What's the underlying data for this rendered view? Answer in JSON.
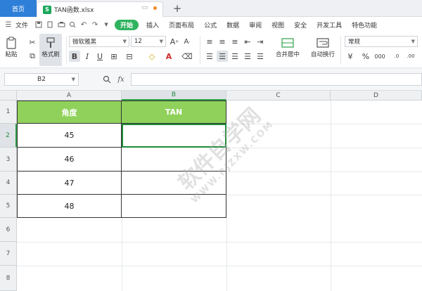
{
  "titlebar": {
    "home_tab": "首页",
    "file_name": "TAN函数.xlsx",
    "new_tab": "+"
  },
  "menubar": {
    "file": "文件",
    "items": [
      "开始",
      "插入",
      "页面布局",
      "公式",
      "数据",
      "审阅",
      "视图",
      "安全",
      "开发工具",
      "特色功能"
    ],
    "active_index": 0
  },
  "ribbon": {
    "paste": "粘贴",
    "format_painter": "格式刷",
    "font_name": "微软雅黑",
    "font_size": "12",
    "merge_center": "合并居中",
    "wrap_text": "自动换行",
    "number_format": "常规",
    "bold": "B",
    "italic": "I",
    "underline": "U",
    "font_color_letter": "A"
  },
  "formula_bar": {
    "name_box": "B2",
    "fx": "fx",
    "formula": ""
  },
  "grid": {
    "columns": [
      "A",
      "B",
      "C",
      "D"
    ],
    "rows": [
      "1",
      "2",
      "3",
      "4",
      "5",
      "6",
      "7",
      "8"
    ],
    "selected_column": "B",
    "selected_row": "2",
    "header_row": [
      "角度",
      "TAN"
    ],
    "data": [
      [
        "45",
        ""
      ],
      [
        "46",
        ""
      ],
      [
        "47",
        ""
      ],
      [
        "48",
        ""
      ]
    ],
    "header_color": "#8fd15a",
    "selection_color": "#1e8c3a"
  },
  "watermark": {
    "text": "软件自学网",
    "sub": "WWW.RJZXW.COM"
  }
}
